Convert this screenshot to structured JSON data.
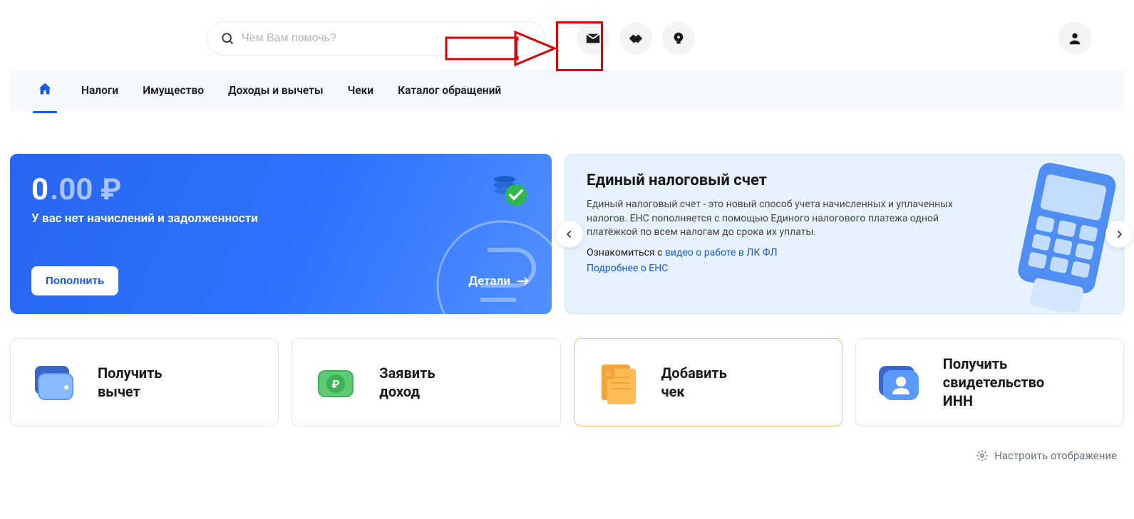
{
  "search": {
    "placeholder": "Чем Вам помочь?"
  },
  "nav": {
    "items": [
      "Налоги",
      "Имущество",
      "Доходы и вычеты",
      "Чеки",
      "Каталог обращений"
    ]
  },
  "balance": {
    "amount_int": "0",
    "amount_frac": ".00 ₽",
    "subtitle": "У вас нет начислений и задолженности",
    "topup_label": "Пополнить",
    "details_label": "Детали"
  },
  "ens": {
    "title": "Единый налоговый счет",
    "text_before_link": "Единый налоговый счет - это новый способ учета начисленных и уплаченных налогов. ЕНС пополняется с помощью Единого налогового платежа одной платёжкой по всем налогам до срока их уплаты.",
    "link1_prefix": "Ознакомиться с ",
    "link1_text": "видео о работе в ЛК ФЛ",
    "link2_text": "Подробнее о ЕНС"
  },
  "actions": [
    {
      "line1": "Получить",
      "line2": "вычет"
    },
    {
      "line1": "Заявить",
      "line2": "доход"
    },
    {
      "line1": "Добавить",
      "line2": "чек"
    },
    {
      "line1": "Получить",
      "line2": "свидетельство",
      "line3": "ИНН"
    }
  ],
  "footer": {
    "display_settings": "Настроить отображение"
  }
}
